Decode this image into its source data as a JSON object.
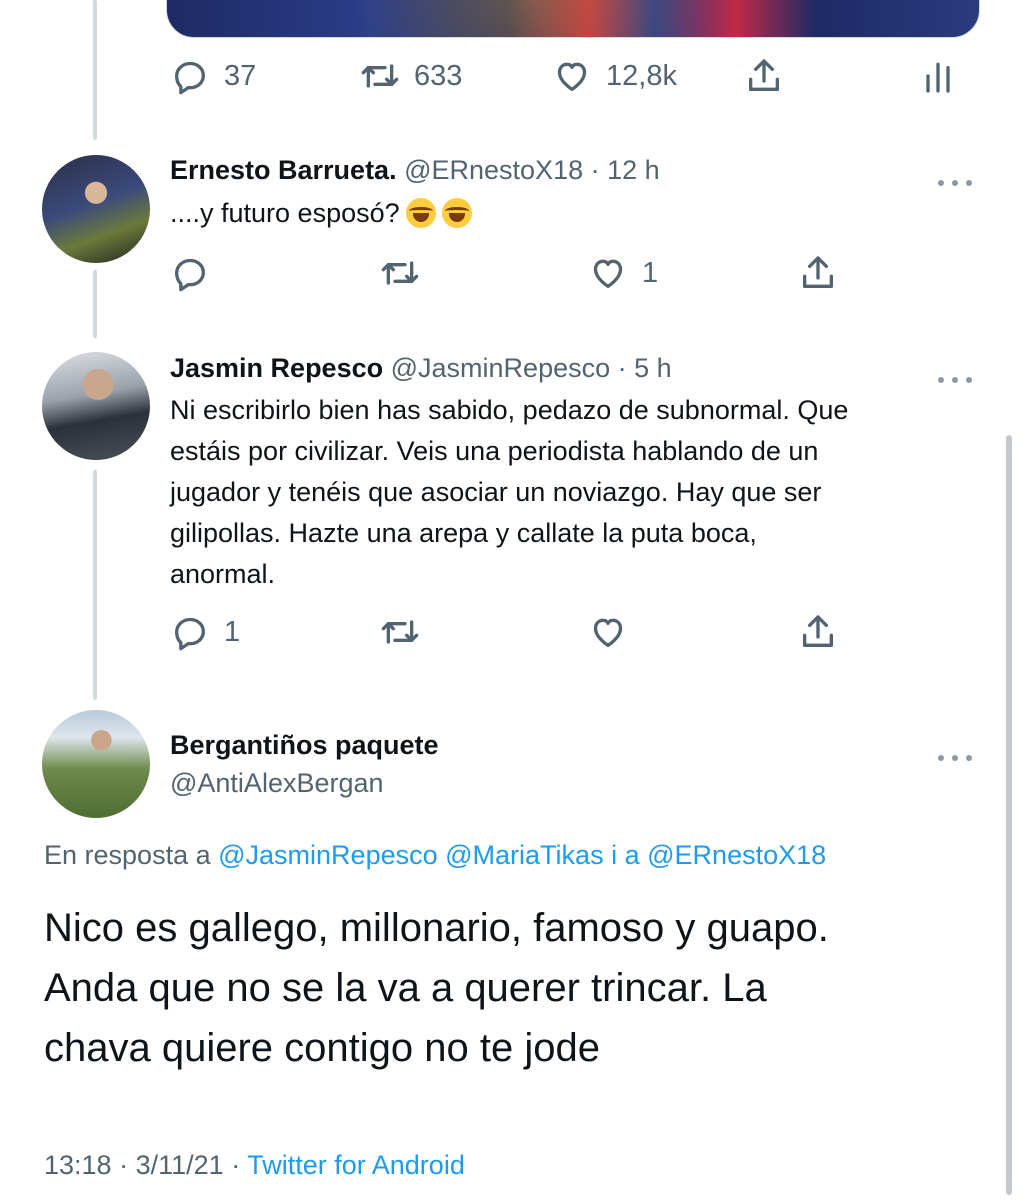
{
  "main_tweet": {
    "replies": "37",
    "retweets": "633",
    "likes": "12,8k"
  },
  "replies": [
    {
      "name": "Ernesto Barrueta.",
      "handle": "@ERnestoX18",
      "time": "· 12 h",
      "text": "....y futuro esposó?",
      "emoji": [
        "face-with-tears-of-joy",
        "face-with-tears-of-joy"
      ],
      "reply_count": "",
      "retweet_count": "",
      "like_count": "1"
    },
    {
      "name": "Jasmin Repesco",
      "handle": "@JasminRepesco",
      "time": "· 5 h",
      "text_lines": [
        "Ni escribirlo bien has sabido, pedazo de subnormal. Que",
        "estáis por civilizar. Veis una periodista hablando de un",
        "jugador y tenéis que asociar un noviazgo. Hay que ser",
        "gilipollas. Hazte una arepa y callate la puta boca,",
        "anormal."
      ],
      "reply_count": "1",
      "retweet_count": "",
      "like_count": ""
    }
  ],
  "focus_tweet": {
    "name": "Bergantiños paquete",
    "handle": "@AntiAlexBergan",
    "reply_prefix": "En resposta a",
    "mentions": [
      "@JasminRepesco",
      "@MariaTikas",
      "i a",
      "@ERnestoX18"
    ],
    "text_lines": [
      "Nico es gallego, millonario, famoso y guapo.",
      "Anda que no se la va a querer trincar. La",
      "chava quiere contigo no te jode"
    ],
    "time": "13:18",
    "date": "3/11/21",
    "source": "Twitter for Android"
  },
  "colors": {
    "link": "#1d9bf0",
    "secondary_text": "#536471",
    "thread_line": "#cfd9de"
  }
}
